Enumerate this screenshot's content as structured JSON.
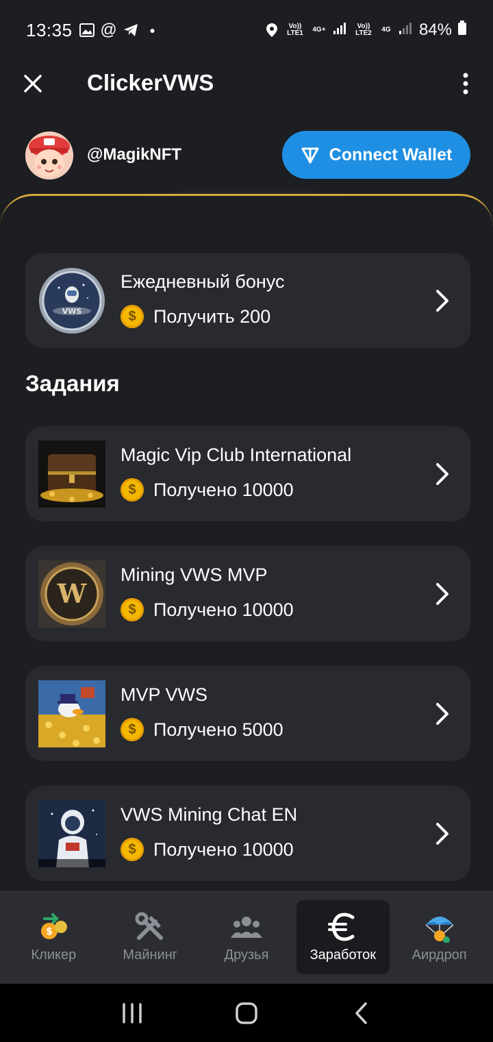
{
  "status_bar": {
    "time": "13:35",
    "battery": "84%",
    "sim1": "Vo)) LTE1",
    "sim1_net": "4G+",
    "sim2": "Vo)) LTE2",
    "sim2_net": "4G"
  },
  "header": {
    "title": "ClickerVWS"
  },
  "profile": {
    "username": "@MagikNFT",
    "wallet_button": "Connect Wallet"
  },
  "daily_bonus": {
    "title": "Ежедневный бонус",
    "reward": "Получить 200"
  },
  "tasks_section": {
    "title": "Задания",
    "items": [
      {
        "title": "Magic Vip Club International",
        "reward": "Получено 10000"
      },
      {
        "title": "Mining VWS MVP",
        "reward": "Получено 10000"
      },
      {
        "title": "MVP VWS",
        "reward": "Получено 5000"
      },
      {
        "title": "VWS Mining Chat EN",
        "reward": "Получено 10000"
      }
    ]
  },
  "bottom_nav": {
    "items": [
      {
        "label": "Кликер"
      },
      {
        "label": "Майнинг"
      },
      {
        "label": "Друзья"
      },
      {
        "label": "Заработок"
      },
      {
        "label": "Аирдроп"
      }
    ],
    "active_index": 3
  },
  "colors": {
    "accent_blue": "#1f8fe3",
    "gold_border": "#d9a83b",
    "coin": "#f5b800",
    "card_bg": "#282a2f"
  }
}
